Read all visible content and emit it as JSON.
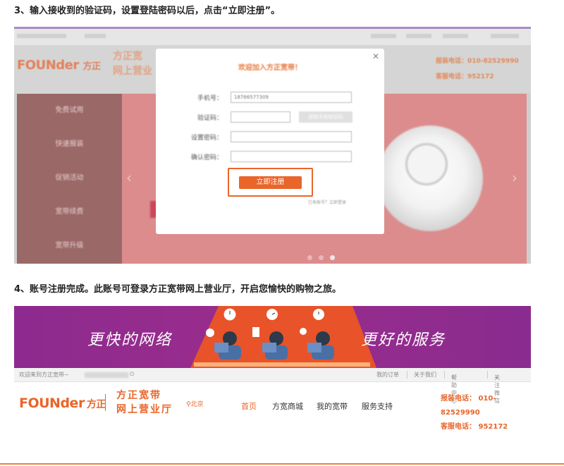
{
  "step3": {
    "title": "3、输入接收到的验证码，设置登陆密码以后，点击“立即注册”。"
  },
  "step4": {
    "title": "4、账号注册完成。此账号可登录方正宽带网上营业厅，开启您愉快的购物之旅。"
  },
  "shot1": {
    "modal": {
      "close_icon": "close-icon",
      "register_label": "立即注册"
    }
  },
  "shot2": {
    "banner": {
      "slogan_left": "更快的网络",
      "slogan_right": "更好的服务"
    },
    "topbar": {
      "welcome": "欢迎来到方正宽带~",
      "power_icon": "power-icon",
      "my_orders": "我的订单",
      "about_us": "关于我们",
      "help_center": "帮助中心",
      "follow_wechat": "关注微信"
    },
    "header": {
      "logo_en": "FOUNder",
      "logo_cn": "方正",
      "brand_line1": "方正宽带",
      "brand_line2": "网上营业厅",
      "city": "北京",
      "nav": [
        "首页",
        "方宽商城",
        "我的宽带",
        "服务支持"
      ],
      "install_phone_label": "报装电话：",
      "install_phone": "010-82529990",
      "service_phone_label": "客服电话：",
      "service_phone": "952172"
    },
    "colors": {
      "accent": "#e9652a",
      "banner_purple": "#8d2a8f"
    }
  }
}
